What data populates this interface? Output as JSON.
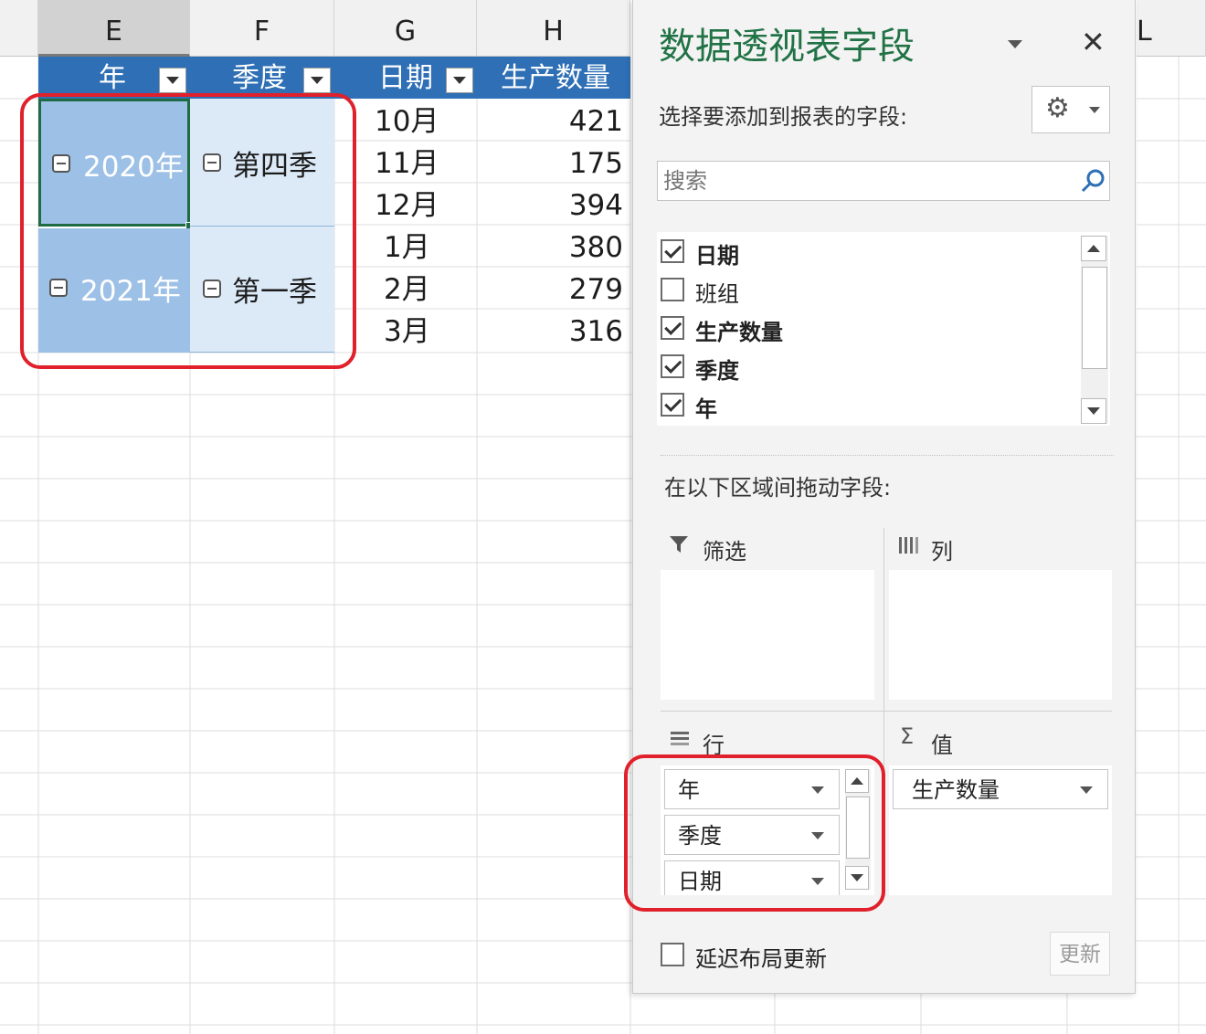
{
  "columns": [
    "E",
    "F",
    "G",
    "H",
    "L"
  ],
  "pivot": {
    "headers": [
      {
        "label": "年",
        "has_filter": true
      },
      {
        "label": "季度",
        "has_filter": true
      },
      {
        "label": "日期",
        "has_filter": true
      },
      {
        "label": "生产数量",
        "has_filter": false
      }
    ],
    "groups": [
      {
        "year": "2020年",
        "quarter": "第四季"
      },
      {
        "year": "2021年",
        "quarter": "第一季"
      }
    ],
    "rows": [
      {
        "date": "10月",
        "qty": "421"
      },
      {
        "date": "11月",
        "qty": "175"
      },
      {
        "date": "12月",
        "qty": "394"
      },
      {
        "date": "1月",
        "qty": "380"
      },
      {
        "date": "2月",
        "qty": "279"
      },
      {
        "date": "3月",
        "qty": "316"
      }
    ]
  },
  "pane": {
    "title": "数据透视表字段",
    "choose_label": "选择要添加到报表的字段:",
    "search_placeholder": "搜索",
    "fields": [
      {
        "label": "日期",
        "checked": true
      },
      {
        "label": "班组",
        "checked": false
      },
      {
        "label": "生产数量",
        "checked": true
      },
      {
        "label": "季度",
        "checked": true
      },
      {
        "label": "年",
        "checked": true
      }
    ],
    "drag_label": "在以下区域间拖动字段:",
    "areas": {
      "filter": "筛选",
      "columns": "列",
      "rows": "行",
      "values": "值"
    },
    "row_fields": [
      "年",
      "季度",
      "日期"
    ],
    "value_fields": [
      "生产数量"
    ],
    "defer_label": "延迟布局更新",
    "update_label": "更新"
  },
  "colors": {
    "header_blue": "#2e6fb5",
    "selected_cell": "#9dc0e6",
    "light_cell": "#dceaf8",
    "highlight_red": "#e0202a",
    "title_green": "#217346"
  }
}
